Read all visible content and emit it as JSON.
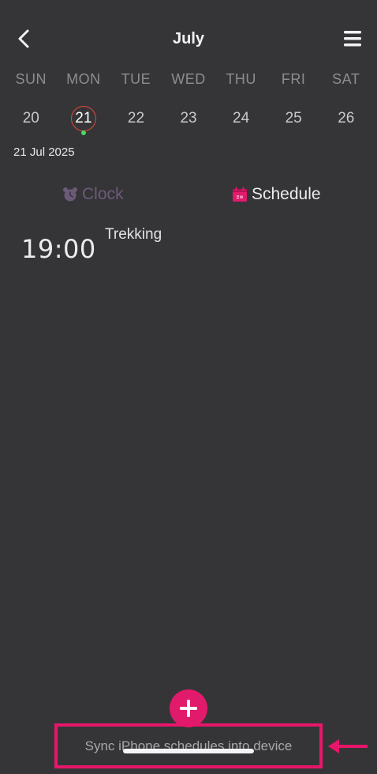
{
  "header": {
    "title": "July"
  },
  "weekdays": [
    "SUN",
    "MON",
    "TUE",
    "WED",
    "THU",
    "FRI",
    "SAT"
  ],
  "dates": [
    {
      "day": "20"
    },
    {
      "day": "21",
      "selected": true,
      "has_event": true
    },
    {
      "day": "22"
    },
    {
      "day": "23"
    },
    {
      "day": "24"
    },
    {
      "day": "25"
    },
    {
      "day": "26"
    }
  ],
  "selected_date_label": "21 Jul 2025",
  "tabs": {
    "clock_label": "Clock",
    "schedule_label": "Schedule",
    "active": "schedule"
  },
  "events": [
    {
      "time": "19:00",
      "title": "Trekking"
    }
  ],
  "sync": {
    "label": "Sync iPhone schedules into device"
  },
  "icons": {
    "back": "chevron-left-icon",
    "menu": "hamburger-menu-icon",
    "clock": "alarm-clock-icon",
    "schedule": "calendar-icon",
    "add": "plus-icon",
    "annotation": "arrow-left-icon"
  },
  "colors": {
    "background": "#353538",
    "accent": "#e21a6b",
    "highlight_border": "#e8166a",
    "selected_ring": "#e0483a",
    "event_dot": "#4cd964",
    "clock_tab": "#6c5a79"
  }
}
